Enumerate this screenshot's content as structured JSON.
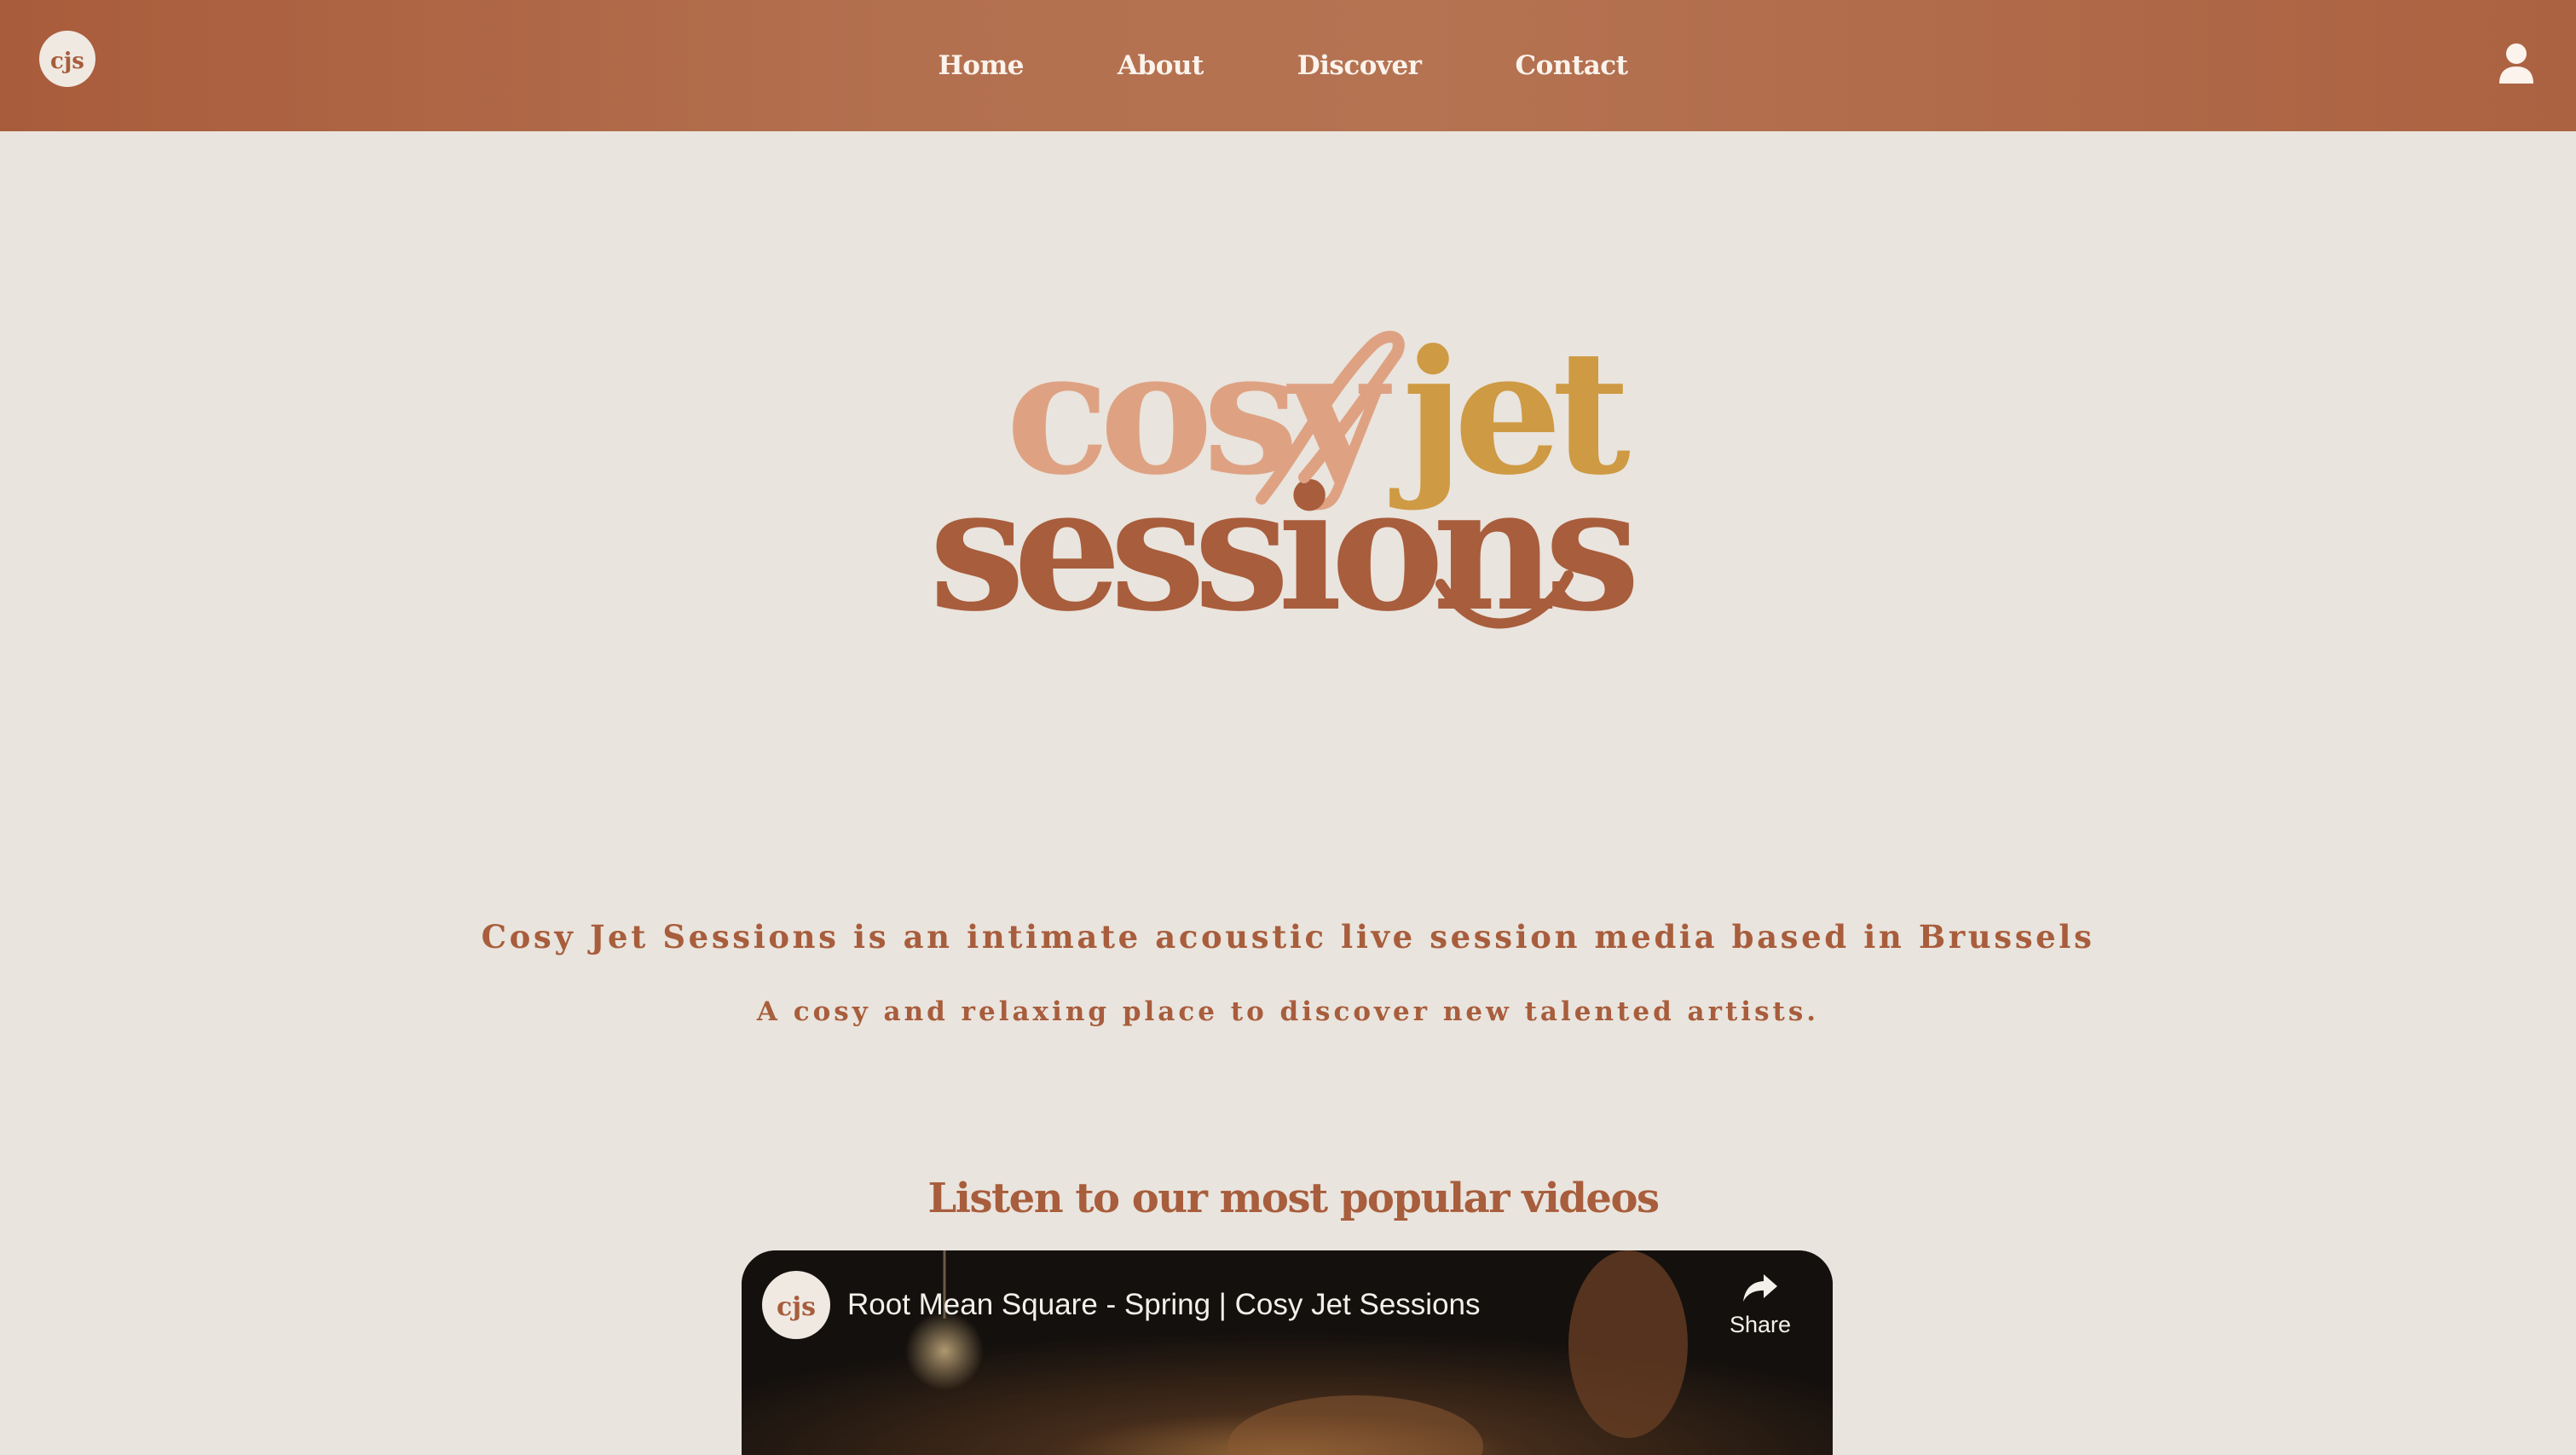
{
  "site": {
    "logo_initials": "cjs"
  },
  "nav": {
    "items": [
      {
        "label": "Home"
      },
      {
        "label": "About"
      },
      {
        "label": "Discover"
      },
      {
        "label": "Contact"
      }
    ]
  },
  "hero": {
    "wordmark_word_1": "cosy",
    "wordmark_word_2": "jet",
    "wordmark_word_3": "sessions"
  },
  "intro": {
    "line_1": "Cosy Jet Sessions is an intimate acoustic live session media based in Brussels",
    "line_2": "A cosy and relaxing place to discover new talented artists."
  },
  "popular": {
    "heading": "Listen to our most popular videos",
    "video": {
      "title": "Root Mean Square - Spring | Cosy Jet Sessions",
      "share_label": "Share"
    }
  },
  "colors": {
    "header_bg": "#ae6a49",
    "page_bg": "#e9e4dd",
    "brand_rust": "#a85d3c",
    "brand_peach": "#dea283",
    "brand_mustard": "#cf9a44",
    "nav_text": "#fbf3ec"
  },
  "icons": {
    "logo": "cjs-monogram-icon",
    "user": "user-icon",
    "share": "share-arrow-icon"
  }
}
